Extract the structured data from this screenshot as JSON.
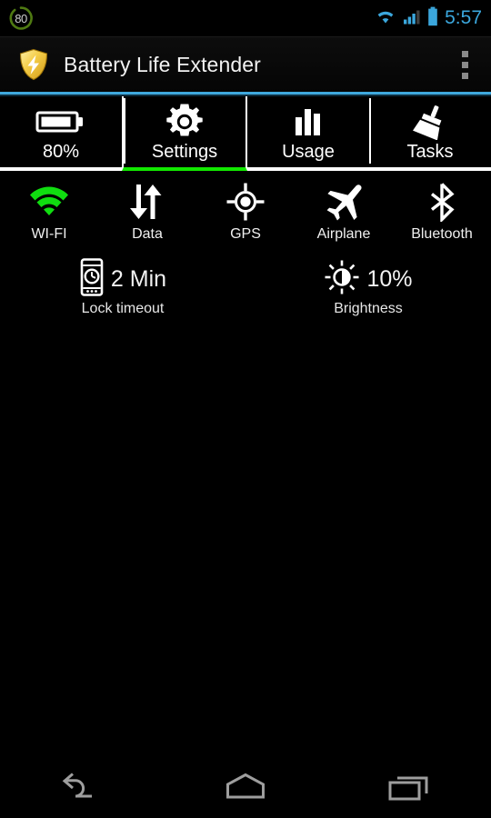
{
  "statusbar": {
    "battery_badge_icon": "battery-circle-icon",
    "battery_badge_value": "80",
    "wifi_icon": "wifi-signal-icon",
    "cell_icon": "cellular-signal-icon",
    "battery_icon": "battery-icon",
    "time": "5:57",
    "time_color": "#3ba7dd"
  },
  "actionbar": {
    "app_icon": "shield-bolt-icon",
    "title": "Battery Life Extender",
    "overflow_icon": "overflow-menu-icon",
    "accent_color": "#3fa9dd"
  },
  "tabs": [
    {
      "label": "80%",
      "icon": "battery-horizontal-icon",
      "selected": false
    },
    {
      "label": "Settings",
      "icon": "gear-icon",
      "selected": true
    },
    {
      "label": "Usage",
      "icon": "bar-chart-icon",
      "selected": false
    },
    {
      "label": "Tasks",
      "icon": "broom-icon",
      "selected": false
    }
  ],
  "selected_tab_underline_color": "#12e800",
  "toggles": [
    {
      "label": "WI-FI",
      "icon": "wifi-icon",
      "state": "on",
      "color": "#10dd10"
    },
    {
      "label": "Data",
      "icon": "data-sync-icon",
      "state": "off",
      "color": "#ffffff"
    },
    {
      "label": "GPS",
      "icon": "gps-icon",
      "state": "off",
      "color": "#ffffff"
    },
    {
      "label": "Airplane",
      "icon": "airplane-icon",
      "state": "off",
      "color": "#ffffff"
    },
    {
      "label": "Bluetooth",
      "icon": "bluetooth-icon",
      "state": "off",
      "color": "#ffffff"
    }
  ],
  "settings": [
    {
      "label": "Lock timeout",
      "value": "2 Min",
      "icon": "phone-clock-icon"
    },
    {
      "label": "Brightness",
      "value": "10%",
      "icon": "brightness-sun-icon"
    }
  ],
  "navbar": [
    {
      "icon": "back-icon"
    },
    {
      "icon": "home-icon"
    },
    {
      "icon": "recents-icon"
    }
  ]
}
